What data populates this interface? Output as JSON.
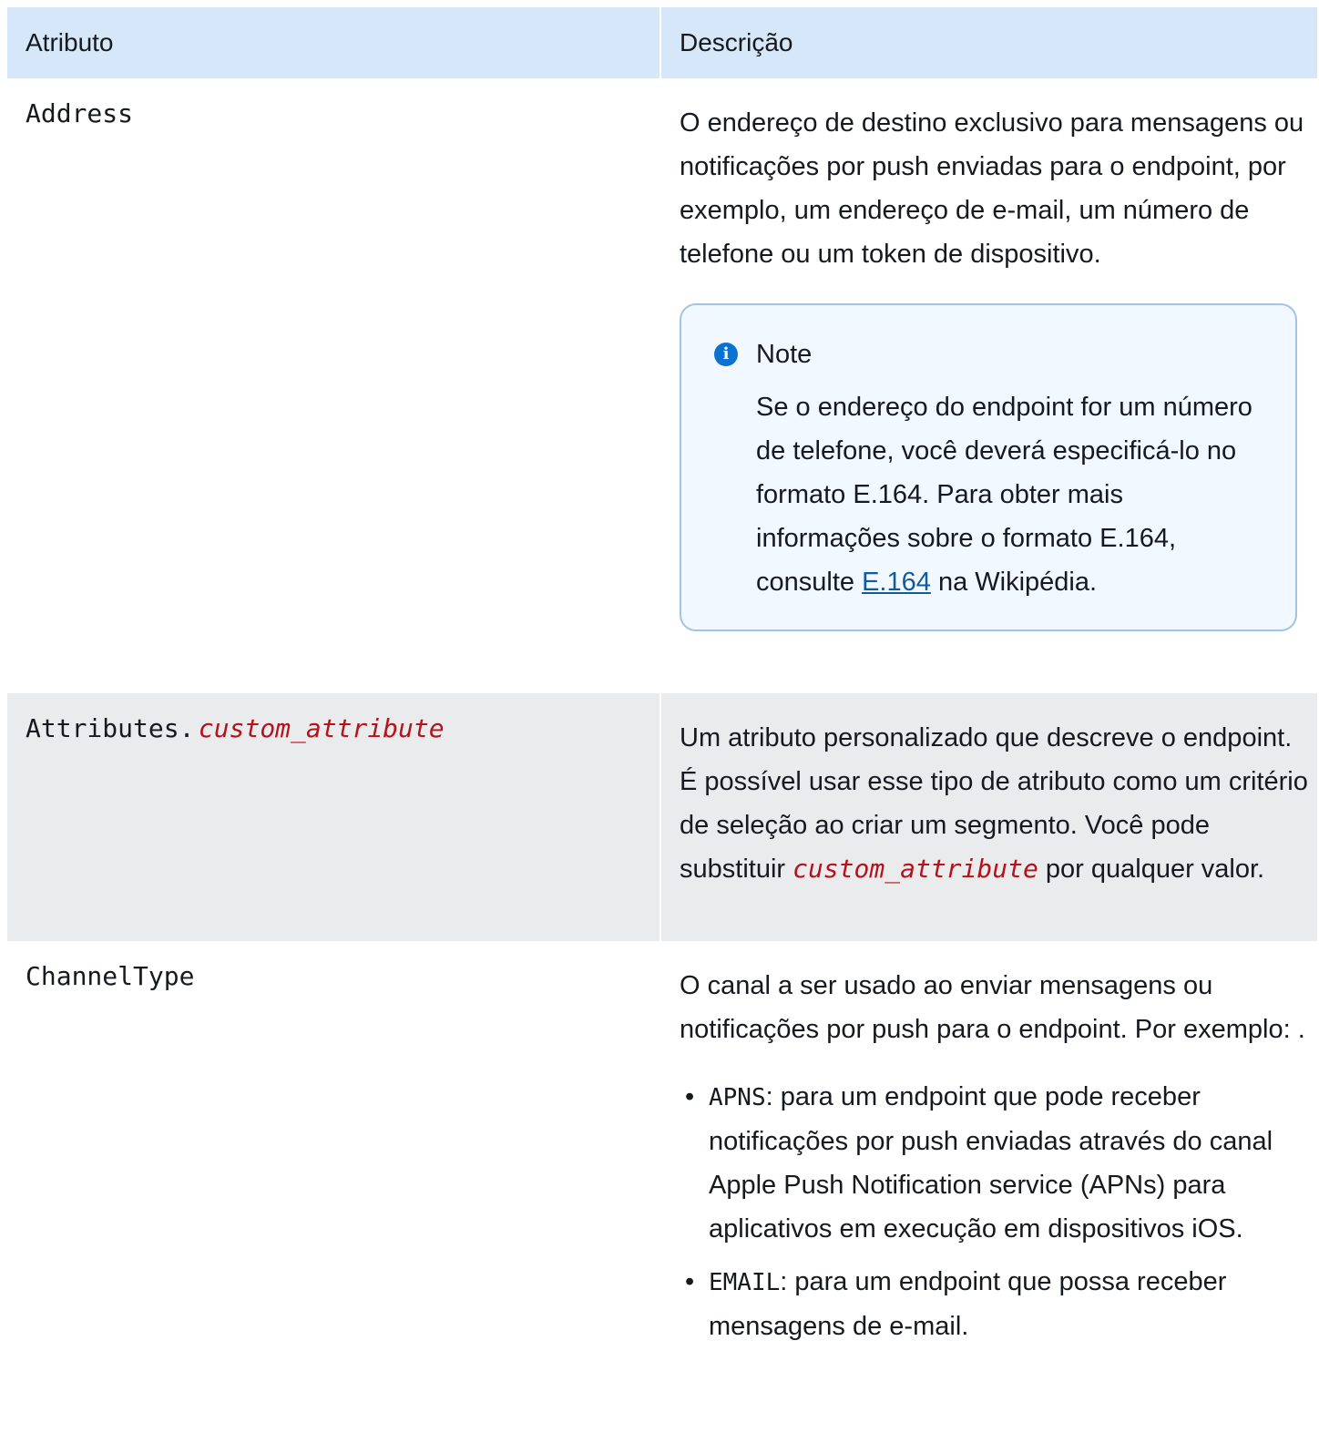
{
  "header": {
    "col1": "Atributo",
    "col2": "Descrição"
  },
  "rows": [
    {
      "name": "Address",
      "description": "O endereço de destino exclusivo para mensagens ou notificações por push enviadas para o endpoint, por exemplo, um endereço de e-mail, um número de telefone ou um token de dispositivo.",
      "note": {
        "title": "Note",
        "text_before": "Se o endereço do endpoint for um número de telefone, você deverá especificá-lo no formato E.164. Para obter mais informações sobre o formato E.164, consulte",
        "link": "E.164",
        "text_after": "na Wikipédia."
      }
    },
    {
      "name_prefix": "Attributes.",
      "name_replaceable": "custom_attribute",
      "description_before": "Um atributo personalizado que descreve o endpoint. É possível usar esse tipo de atributo como um critério de seleção ao criar um segmento. Você pode substituir",
      "description_replaceable": "custom_attribute",
      "description_after": "por qualquer valor."
    },
    {
      "name": "ChannelType",
      "description": "O canal a ser usado ao enviar mensagens ou notificações por push para o endpoint. Por exemplo: .",
      "bullets": [
        {
          "code": "APNS",
          "text": ": para um endpoint que pode receber notificações por push enviadas através do canal Apple Push Notification service (APNs) para aplicativos em execução em dispositivos iOS."
        },
        {
          "code": "EMAIL",
          "text": ": para um endpoint que possa receber mensagens de e-mail."
        }
      ]
    }
  ]
}
